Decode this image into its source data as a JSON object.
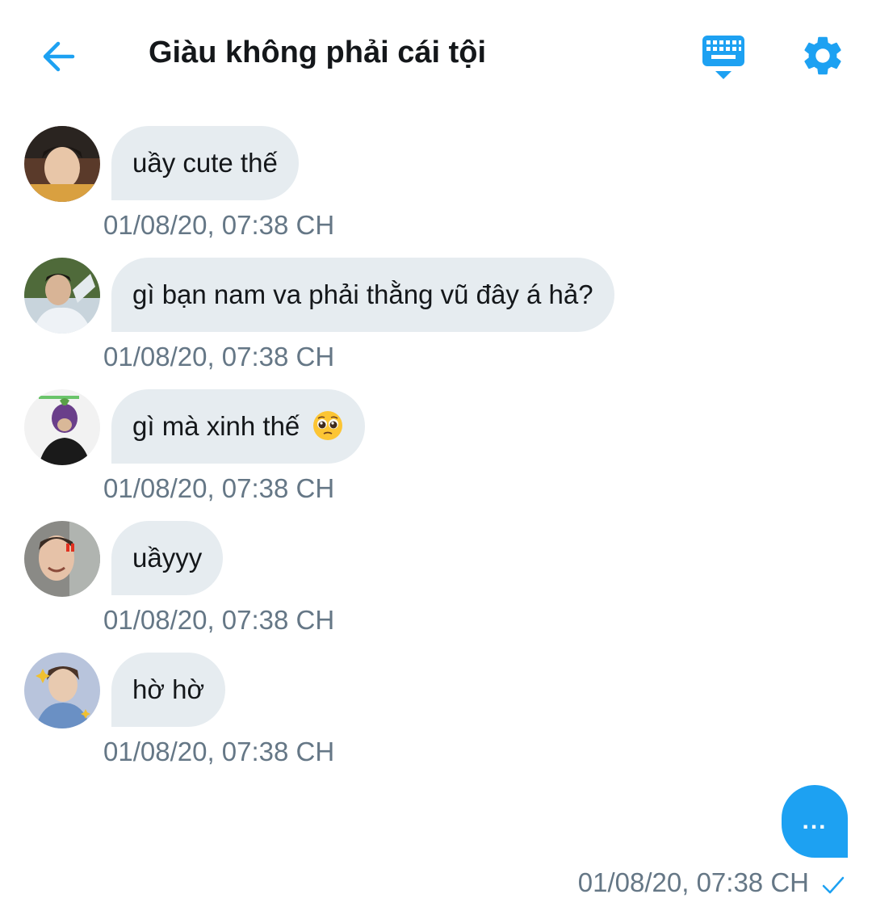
{
  "header": {
    "title": "Giàu không phải cái tội",
    "accent_color": "#1da1f2",
    "icons": [
      "back-arrow-icon",
      "keyboard-icon",
      "gear-icon"
    ]
  },
  "messages": [
    {
      "text": "uầy cute thế",
      "timestamp": "01/08/20, 07:38 CH"
    },
    {
      "text": "gì bạn nam va phải thằng vũ đây á hả?",
      "timestamp": "01/08/20, 07:38 CH"
    },
    {
      "text": "gì mà xinh thế",
      "emoji": "pleading-face-emoji",
      "timestamp": "01/08/20, 07:38 CH"
    },
    {
      "text": "uầyyy",
      "timestamp": "01/08/20, 07:38 CH"
    },
    {
      "text": "hờ hờ",
      "timestamp": "01/08/20, 07:38 CH"
    }
  ],
  "own_message": {
    "text": "...",
    "timestamp": "01/08/20, 07:38 CH",
    "status_icon": "check-icon"
  },
  "colors": {
    "bubble_incoming": "#e6ecf0",
    "bubble_outgoing": "#1da1f2",
    "text_primary": "#14171a",
    "text_secondary": "#657786"
  }
}
